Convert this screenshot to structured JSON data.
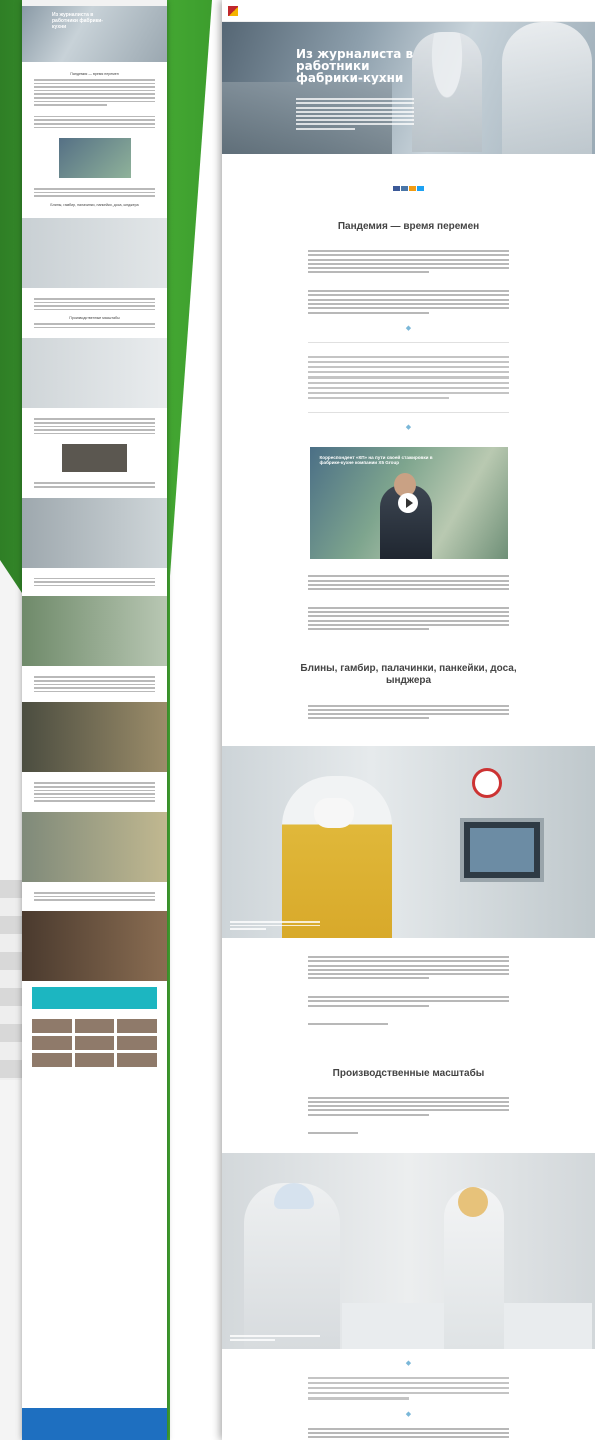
{
  "article": {
    "hero_title": "Из журналиста в работники фабрики-кухни",
    "section1_title": "Пандемия — время перемен",
    "video_title": "Корреспондент «КП» на пути своей стажировки в фабрике-кухне компании X5 Group",
    "section2_title": "Блины, гамбир, палачинки, панкейки, доса, ынджера",
    "section3_title": "Производственные масштабы"
  },
  "colors": {
    "brand_red": "#c0272d",
    "accent_green": "#3f9e2f",
    "teal_box": "#1cb6c1",
    "footer_blue": "#1e6fc0"
  }
}
